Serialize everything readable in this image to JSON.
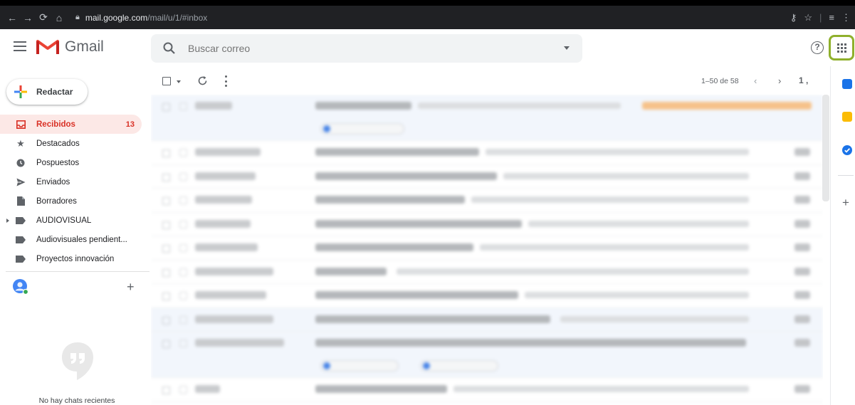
{
  "browser": {
    "url_host": "mail.google.com",
    "url_path": "/mail/u/1/#inbox"
  },
  "header": {
    "logo_text": "Gmail",
    "search_placeholder": "Buscar correo",
    "help_label": "?"
  },
  "compose": {
    "label": "Redactar"
  },
  "sidebar": {
    "items": [
      {
        "label": "Recibidos",
        "count": "13",
        "icon": "inbox-icon"
      },
      {
        "label": "Destacados",
        "count": "",
        "icon": "star-icon"
      },
      {
        "label": "Pospuestos",
        "count": "",
        "icon": "clock-icon"
      },
      {
        "label": "Enviados",
        "count": "",
        "icon": "send-icon"
      },
      {
        "label": "Borradores",
        "count": "",
        "icon": "draft-icon"
      },
      {
        "label": "AUDIOVISUAL",
        "count": "",
        "icon": "label-icon"
      },
      {
        "label": "Audiovisuales pendient...",
        "count": "",
        "icon": "label-icon"
      },
      {
        "label": "Proyectos innovación",
        "count": "",
        "icon": "label-icon"
      }
    ],
    "hangouts_add": "+",
    "no_chats": "No hay chats recientes"
  },
  "toolbar": {
    "pagination": "1–50 de 58",
    "prev": "‹",
    "next": "›",
    "input_tools": "1 ,"
  },
  "sidepanel": {
    "add": "+"
  },
  "colors": {
    "accent_red": "#d93025",
    "active_bg": "#fce8e6",
    "apps_highlight": "#8fb02c"
  }
}
